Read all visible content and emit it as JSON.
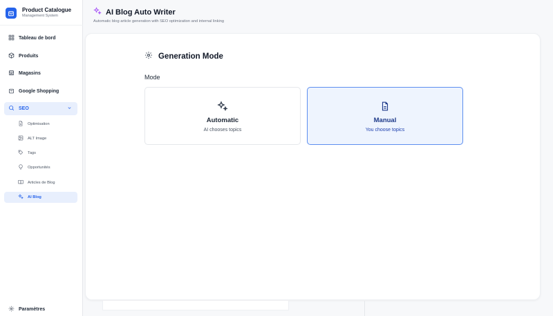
{
  "brand": {
    "title": "Product Catalogue",
    "subtitle": "Management System"
  },
  "nav": {
    "dashboard": "Tableau de bord",
    "products": "Produits",
    "stores": "Magasins",
    "google_shopping": "Google Shopping",
    "seo": "SEO",
    "seo_sub": {
      "optimisation": "Optimisation",
      "alt_image": "ALT Image",
      "tags": "Tags",
      "opportunites": "Opportunités",
      "articles": "Articles de Blog",
      "ai_blog": "AI Blog"
    },
    "settings": "Paramètres"
  },
  "header": {
    "title": "AI Blog Auto Writer",
    "subtitle": "Automatic blog article generation with SEO optimization and internal linking"
  },
  "generation": {
    "title": "Generation Mode",
    "mode_label": "Mode",
    "options": [
      {
        "title": "Automatic",
        "desc": "AI chooses topics"
      },
      {
        "title": "Manual",
        "desc": "You choose topics"
      }
    ],
    "selected": "Manual"
  },
  "colors": {
    "accent": "#2563eb",
    "selected_bg": "#eef4fe",
    "sparkle": "#a855f7"
  }
}
